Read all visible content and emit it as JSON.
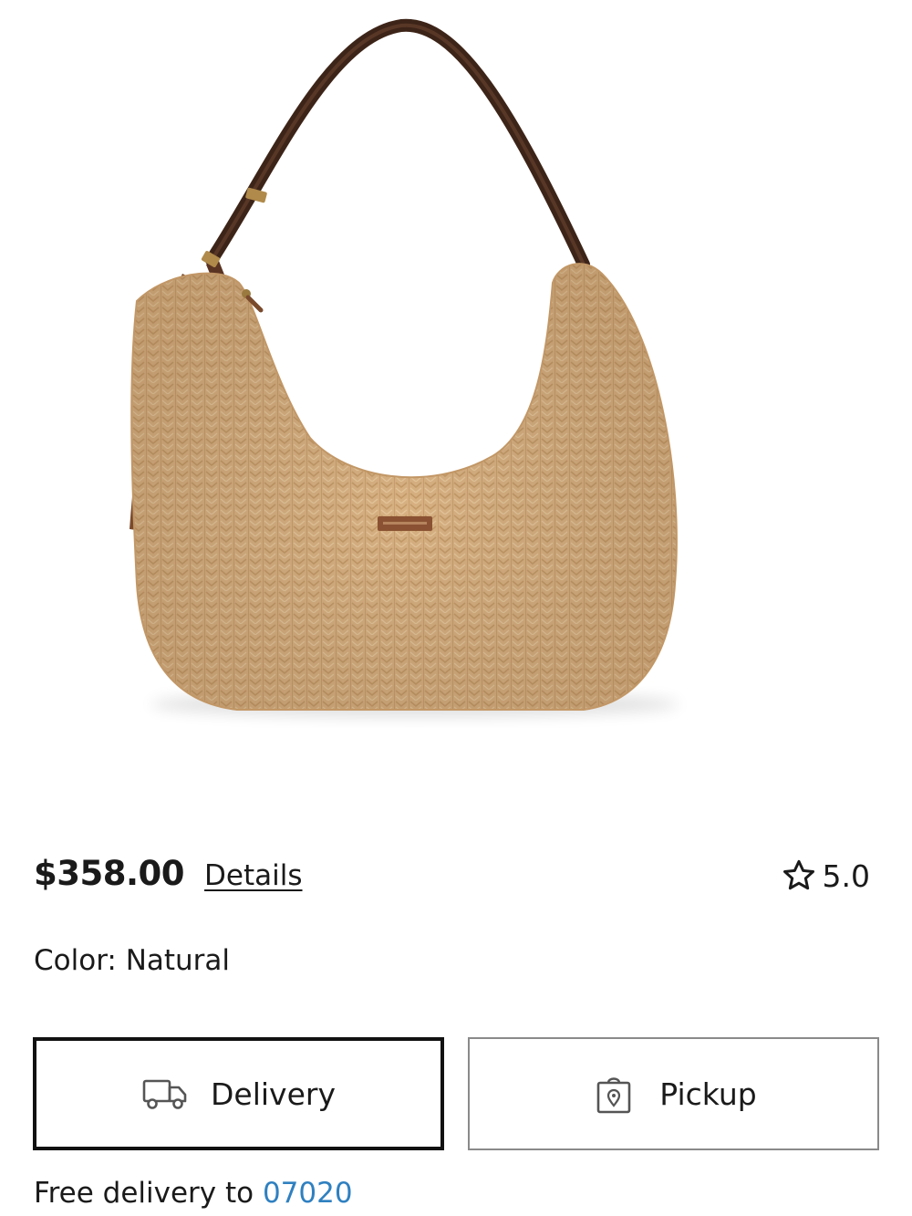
{
  "product": {
    "image_alt": "Woven straw crescent shoulder bag with brown leather strap",
    "price": "$358.00",
    "details_label": "Details",
    "rating": "5.0",
    "color_label": "Color: Natural"
  },
  "fulfillment": {
    "delivery_label": "Delivery",
    "pickup_label": "Pickup",
    "free_delivery_prefix": "Free delivery to ",
    "zip": "07020"
  },
  "icons": {
    "rating": "star-outline-icon",
    "delivery": "truck-icon",
    "pickup": "shopping-bag-location-icon"
  },
  "colors": {
    "text": "#1a1a1a",
    "link_blue": "#2f80c0",
    "selected_border": "#111111",
    "unselected_border": "#8a8a8a",
    "straw": "#d9b384",
    "leather": "#4a2a1c"
  }
}
